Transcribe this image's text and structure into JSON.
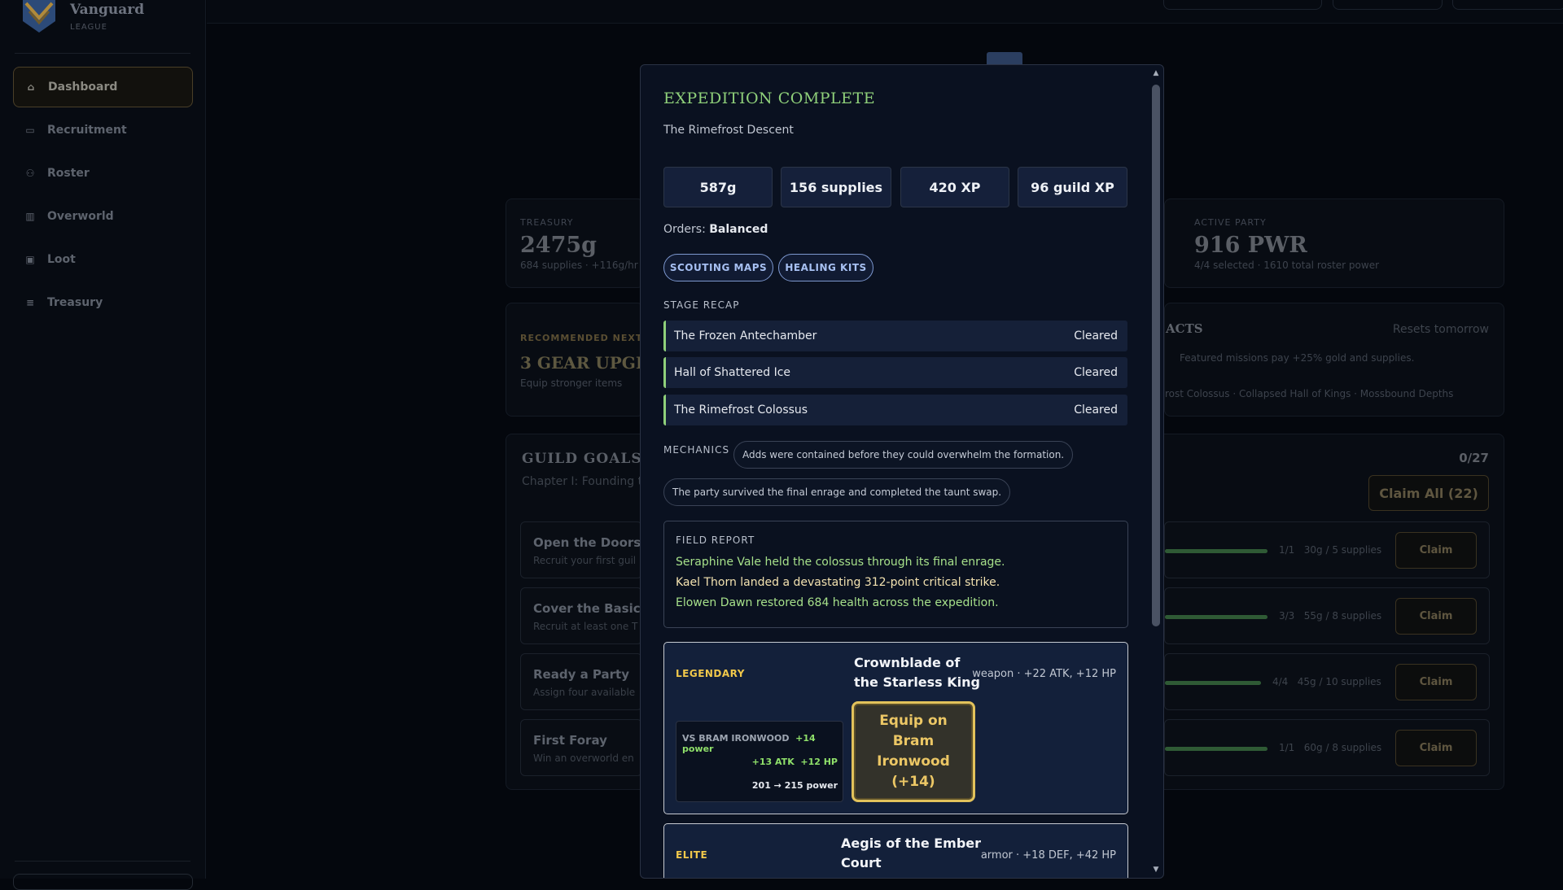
{
  "brand": {
    "name": "Vanguard",
    "sub": "LEAGUE"
  },
  "sidebar": {
    "items": [
      {
        "label": "Dashboard",
        "icon": "home-icon",
        "active": true
      },
      {
        "label": "Recruitment",
        "icon": "message-icon"
      },
      {
        "label": "Roster",
        "icon": "users-icon"
      },
      {
        "label": "Overworld",
        "icon": "map-icon"
      },
      {
        "label": "Loot",
        "icon": "bag-icon"
      },
      {
        "label": "Treasury",
        "icon": "coins-icon"
      }
    ]
  },
  "dashboard": {
    "treasury": {
      "kicker": "TREASURY",
      "value": "2475g",
      "sub": "684 supplies · +116g/hr"
    },
    "active_party": {
      "kicker": "ACTIVE PARTY",
      "value": "916 PWR",
      "sub": "4/4 selected · 1610 total roster power"
    },
    "recommended": {
      "kicker": "RECOMMENDED NEXT",
      "title": "3 GEAR UPGRA",
      "sub": "Equip stronger items"
    },
    "contracts": {
      "title": "ACTS",
      "resets": "Resets tomorrow",
      "line1": "Featured missions pay +25% gold and supplies.",
      "line2": "rost Colossus · Collapsed Hall of Kings · Mossbound Depths"
    },
    "guild_goals": {
      "title": "GUILD GOALS",
      "chapter": "Chapter I: Founding th",
      "count": "0/27",
      "claim_all": "Claim All (22)",
      "goals": [
        {
          "title": "Open the Doors",
          "sub": "Recruit your first guil",
          "progress": "1/1",
          "reward": "30g / 5 supplies",
          "claim": "Claim",
          "fill": 1.0
        },
        {
          "title": "Cover the Basics",
          "sub": "Recruit at least one T",
          "progress": "3/3",
          "reward": "55g / 8 supplies",
          "claim": "Claim",
          "fill": 1.0
        },
        {
          "title": "Ready a Party",
          "sub": "Assign four available",
          "progress": "4/4",
          "reward": "45g / 10 supplies",
          "claim": "Claim",
          "fill": 1.0
        },
        {
          "title": "First Foray",
          "sub": "Win an overworld en",
          "progress": "1/1",
          "reward": "60g / 8 supplies",
          "claim": "Claim",
          "fill": 1.0
        }
      ]
    }
  },
  "modal": {
    "title": "EXPEDITION COMPLETE",
    "subtitle": "The Rimefrost Descent",
    "rewards": [
      "587g",
      "156 supplies",
      "420 XP",
      "96 guild XP"
    ],
    "orders_label": "Orders:",
    "orders_value": "Balanced",
    "tags": [
      "SCOUTING MAPS",
      "HEALING KITS"
    ],
    "stage_recap_label": "STAGE RECAP",
    "stages": [
      {
        "name": "The Frozen Antechamber",
        "status": "Cleared"
      },
      {
        "name": "Hall of Shattered Ice",
        "status": "Cleared"
      },
      {
        "name": "The Rimefrost Colossus",
        "status": "Cleared"
      }
    ],
    "mechanics_label": "MECHANICS",
    "mechanics": [
      "Adds were contained before they could overwhelm the formation.",
      "The party survived the final enrage and completed the taunt swap."
    ],
    "field_report_label": "FIELD REPORT",
    "field_report": [
      {
        "text": "Seraphine Vale held the colossus through its final enrage.",
        "color": "#a6e08a"
      },
      {
        "text": "Kael Thorn landed a devastating 312-point critical strike.",
        "color": "#f3e2b0"
      },
      {
        "text": "Elowen Dawn restored 684 health across the expedition.",
        "color": "#a6e08a"
      }
    ],
    "loot": [
      {
        "rarity": "LEGENDARY",
        "name_line1": "Crownblade of",
        "name_line2": "the Starless King",
        "stats": "weapon · +22 ATK, +12 HP",
        "compare_head": "VS BRAM IRONWOOD",
        "compare_power": "+14 power",
        "compare_stats": "+13 ATK  +12 HP",
        "compare_total": "201 → 215 power",
        "equip_line1": "Equip on",
        "equip_line2": "Bram",
        "equip_line3": "Ironwood",
        "equip_line4": "(+14)"
      },
      {
        "rarity": "ELITE",
        "name_line1": "Aegis of the Ember",
        "name_line2": "Court",
        "stats": "armor · +18 DEF, +42 HP"
      }
    ],
    "colors": {
      "accent_green": "#8fd07a",
      "legendary": "#f1c84b",
      "tag_blue": "#a7c0f2"
    }
  }
}
